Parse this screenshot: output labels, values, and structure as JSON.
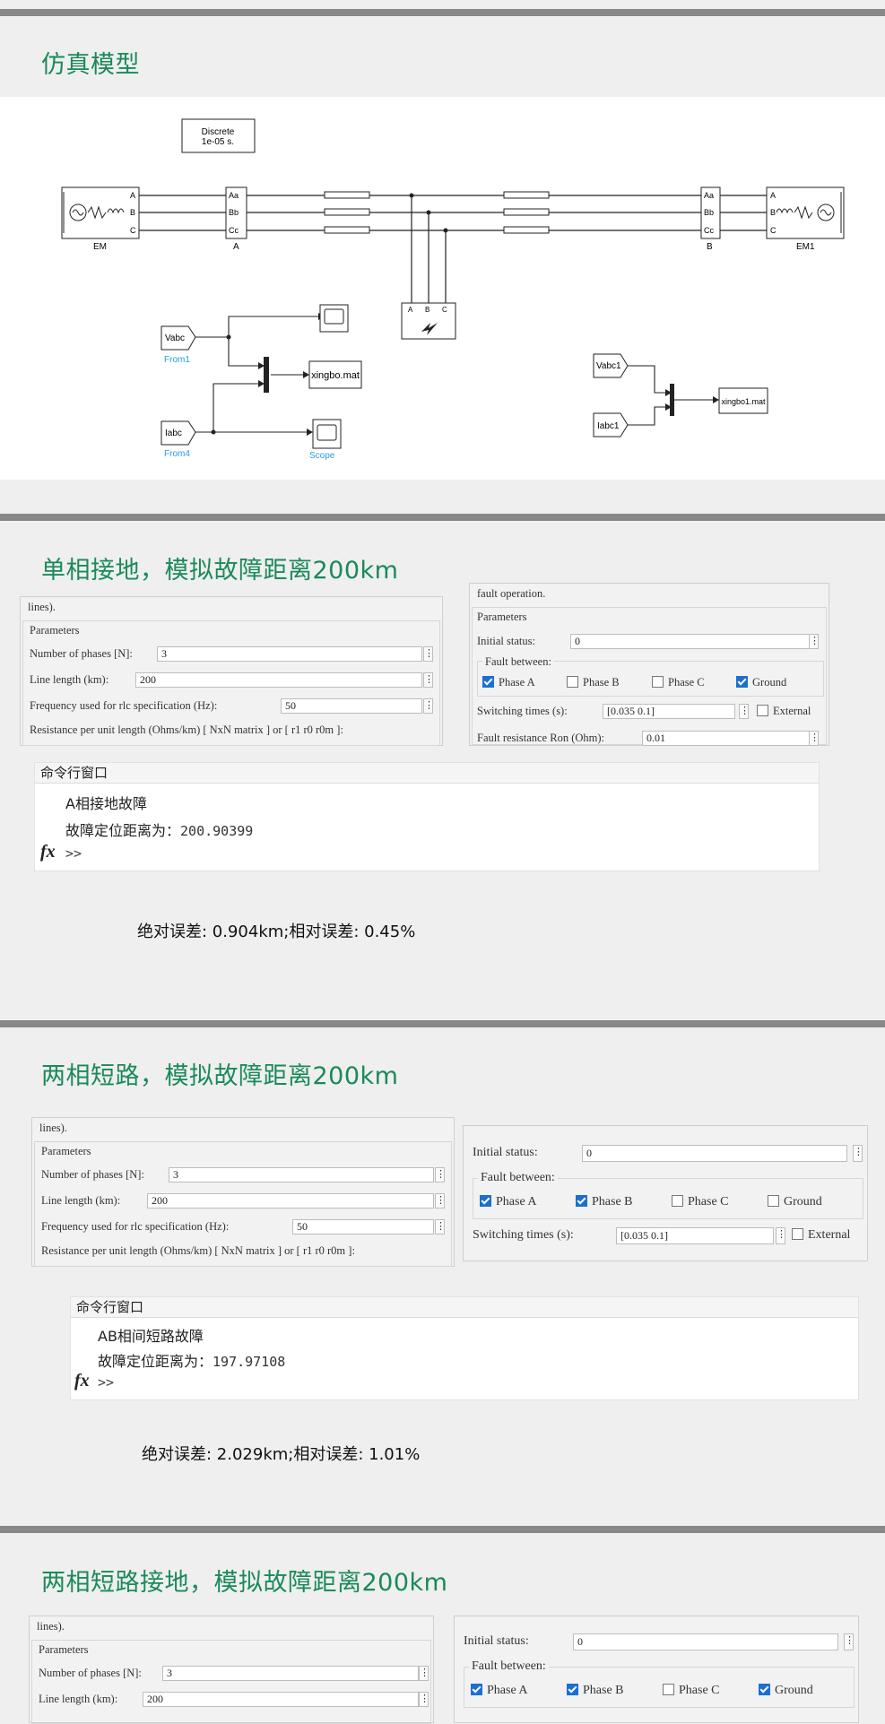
{
  "section1": {
    "title": "仿真模型",
    "model": {
      "powergui": [
        "Discrete",
        "1e-05 s."
      ],
      "source_left": "EM",
      "source_right": "EM1",
      "bus_left": "A",
      "bus_right": "B",
      "phase_labels": [
        "A",
        "B",
        "C"
      ],
      "bus_ports": [
        "Aa",
        "Bb",
        "Cc"
      ],
      "from1": "Vabc",
      "from1_label": "From1",
      "from4": "Iabc",
      "from4_label": "From4",
      "tofile1": "xingbo.mat",
      "scope_label": "Scope",
      "vabc1": "Vabc1",
      "iabc1": "Iabc1",
      "tofile2": "xingbo1.mat"
    }
  },
  "line_dialog": {
    "lines_text": "lines).",
    "parameters": "Parameters",
    "phases_label": "Number of phases [N]:",
    "phases_value": "3",
    "length_label": "Line length (km):",
    "length_value": "200",
    "freq_label": "Frequency used for rlc specification (Hz):",
    "freq_value": "50",
    "resistance_label": "Resistance per unit length (Ohms/km) [ NxN matrix ] or [ r1 r0 r0m ]:"
  },
  "fault_dialog": {
    "fault_operation": "fault operation.",
    "parameters": "Parameters",
    "initial_label": "Initial status:",
    "initial_value": "0",
    "fault_between": "Fault between:",
    "phase_a": "Phase A",
    "phase_b": "Phase B",
    "phase_c": "Phase C",
    "ground": "Ground",
    "switching_label": "Switching times (s):",
    "switching_value": "[0.035  0.1]",
    "external": "External",
    "ron_label": "Fault resistance Ron (Ohm):",
    "ron_value": "0.01"
  },
  "section2": {
    "title": "单相接地，模拟故障距离200km",
    "checks": {
      "a": true,
      "b": false,
      "c": false,
      "g": true
    },
    "cmd_title": "命令行窗口",
    "line1": "A相接地故障",
    "line2_label": "故障定位距离为：",
    "line2_value": "200.90399",
    "prompt": ">>",
    "fx": "fx",
    "error": "绝对误差: 0.904km;相对误差: 0.45%"
  },
  "section3": {
    "title": "两相短路，模拟故障距离200km",
    "checks": {
      "a": true,
      "b": true,
      "c": false,
      "g": false
    },
    "cmd_title": "命令行窗口",
    "line1": "AB相间短路故障",
    "line2_label": "故障定位距离为：",
    "line2_value": "197.97108",
    "prompt": ">>",
    "fx": "fx",
    "error": "绝对误差: 2.029km;相对误差: 1.01%"
  },
  "section4": {
    "title": "两相短路接地，模拟故障距离200km",
    "checks": {
      "a": true,
      "b": true,
      "c": false,
      "g": true
    }
  },
  "colors": {
    "title_green": "#1a8a5a",
    "check_blue": "#1c6fd1",
    "link_blue": "#2a9be8"
  }
}
